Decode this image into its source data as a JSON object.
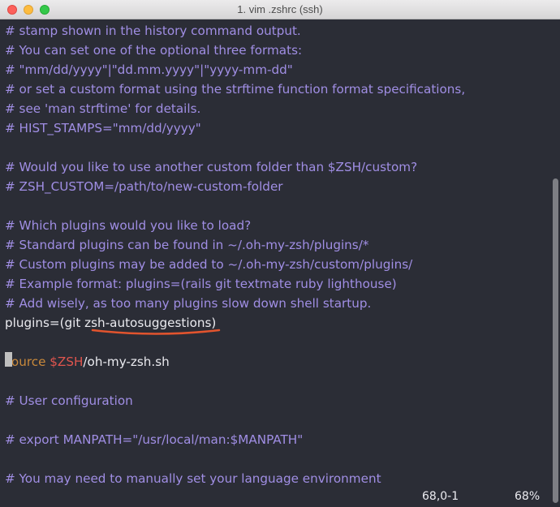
{
  "window": {
    "title": "1. vim .zshrc (ssh)"
  },
  "editor": {
    "lines": [
      "# stamp shown in the history command output.",
      "# You can set one of the optional three formats:",
      "# \"mm/dd/yyyy\"|\"dd.mm.yyyy\"|\"yyyy-mm-dd\"",
      "# or set a custom format using the strftime function format specifications,",
      "# see 'man strftime' for details.",
      "# HIST_STAMPS=\"mm/dd/yyyy\"",
      "",
      "# Would you like to use another custom folder than $ZSH/custom?",
      "# ZSH_CUSTOM=/path/to/new-custom-folder",
      "",
      "# Which plugins would you like to load?",
      "# Standard plugins can be found in ~/.oh-my-zsh/plugins/*",
      "# Custom plugins may be added to ~/.oh-my-zsh/custom/plugins/",
      "# Example format: plugins=(rails git textmate ruby lighthouse)",
      "# Add wisely, as too many plugins slow down shell startup.",
      "plugins=(git zsh-autosuggestions)",
      "",
      "source $ZSH/oh-my-zsh.sh",
      "",
      "# User configuration",
      "",
      "# export MANPATH=\"/usr/local/man:$MANPATH\"",
      "",
      "# You may need to manually set your language environment"
    ],
    "source_line": {
      "keyword": "source",
      "variable": "$ZSH",
      "rest": "/oh-my-zsh.sh"
    }
  },
  "statusbar": {
    "position": "68,0-1",
    "percent": "68%"
  },
  "colors": {
    "background": "#2b2d36",
    "comment": "#a08ee4",
    "text": "#ebebf0",
    "keyword": "#c9893b",
    "variable": "#e0554e",
    "annotation": "#e2542e"
  }
}
